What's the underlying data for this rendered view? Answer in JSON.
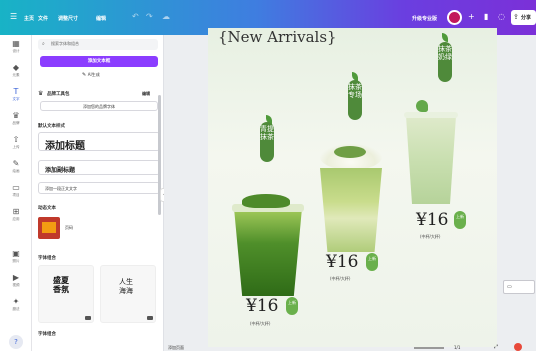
{
  "topbar": {
    "home_label": "主页",
    "file_label": "文件",
    "resize_label": "调整尺寸",
    "edit_label": "编辑",
    "upgrade_label": "升级专业版",
    "share_label": "分享"
  },
  "rail": {
    "items": [
      {
        "label": "设计",
        "icon": "layout-icon"
      },
      {
        "label": "元素",
        "icon": "shapes-icon"
      },
      {
        "label": "文字",
        "icon": "text-icon"
      },
      {
        "label": "品牌",
        "icon": "brand-icon"
      },
      {
        "label": "上传",
        "icon": "upload-icon"
      },
      {
        "label": "绘画",
        "icon": "draw-icon"
      },
      {
        "label": "项目",
        "icon": "folder-icon"
      },
      {
        "label": "应用",
        "icon": "apps-icon"
      },
      {
        "label": "照片",
        "icon": "photo-icon"
      },
      {
        "label": "视频",
        "icon": "video-icon"
      },
      {
        "label": "魔法",
        "icon": "magic-icon"
      }
    ]
  },
  "panel": {
    "search_placeholder": "搜索字体和组合",
    "add_text_button": "添加文本框",
    "magic_write": "AI生成",
    "brand_kit_label": "品牌工具包",
    "brand_kit_edit": "编辑",
    "brand_kit_action": "添加您的品牌字体",
    "default_styles_label": "默认文本样式",
    "heading": "添加标题",
    "subheading": "添加副标题",
    "body_text": "添加一段正文文字",
    "dynamic_text_label": "动态文本",
    "dynamic_text_item": "页码",
    "font_combos_label": "字体组合",
    "combo_1": "盛夏香氛",
    "combo_2": "人生海海",
    "recent_label": "字体组合"
  },
  "poster": {
    "title": "{New Arrivals}",
    "drinks": [
      {
        "name": "青提抹茶",
        "price": "¥16",
        "badge": "上新",
        "size": "(中杯/大杯)"
      },
      {
        "name": "抹茶专场",
        "price": "¥16",
        "badge": "上新",
        "size": "(中杯/大杯)"
      },
      {
        "name": "抹茶奶绿",
        "price": "¥16",
        "badge": "上新",
        "size": "(中杯/大杯)"
      }
    ]
  },
  "canvas": {
    "add_page_label": "添加页面",
    "page_indicator": "1/1"
  },
  "colors": {
    "accent": "#8b3dff",
    "matcha": "#4f8a3a",
    "badge": "#6ab04c"
  }
}
